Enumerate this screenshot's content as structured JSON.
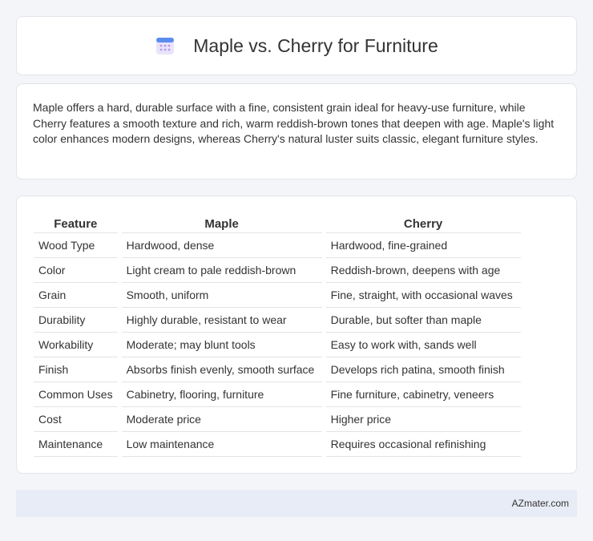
{
  "header": {
    "title": "Maple vs. Cherry for Furniture",
    "icon": "calendar-icon"
  },
  "intro": {
    "text": "Maple offers a hard, durable surface with a fine, consistent grain ideal for heavy-use furniture, while Cherry features a smooth texture and rich, warm reddish-brown tones that deepen with age. Maple's light color enhances modern designs, whereas Cherry's natural luster suits classic, elegant furniture styles."
  },
  "table": {
    "headers": [
      "Feature",
      "Maple",
      "Cherry"
    ],
    "rows": [
      [
        "Wood Type",
        "Hardwood, dense",
        "Hardwood, fine-grained"
      ],
      [
        "Color",
        "Light cream to pale reddish-brown",
        "Reddish-brown, deepens with age"
      ],
      [
        "Grain",
        "Smooth, uniform",
        "Fine, straight, with occasional waves"
      ],
      [
        "Durability",
        "Highly durable, resistant to wear",
        "Durable, but softer than maple"
      ],
      [
        "Workability",
        "Moderate; may blunt tools",
        "Easy to work with, sands well"
      ],
      [
        "Finish",
        "Absorbs finish evenly, smooth surface",
        "Develops rich patina, smooth finish"
      ],
      [
        "Common Uses",
        "Cabinetry, flooring, furniture",
        "Fine furniture, cabinetry, veneers"
      ],
      [
        "Cost",
        "Moderate price",
        "Higher price"
      ],
      [
        "Maintenance",
        "Low maintenance",
        "Requires occasional refinishing"
      ]
    ]
  },
  "footer": {
    "text": "AZmater.com"
  }
}
